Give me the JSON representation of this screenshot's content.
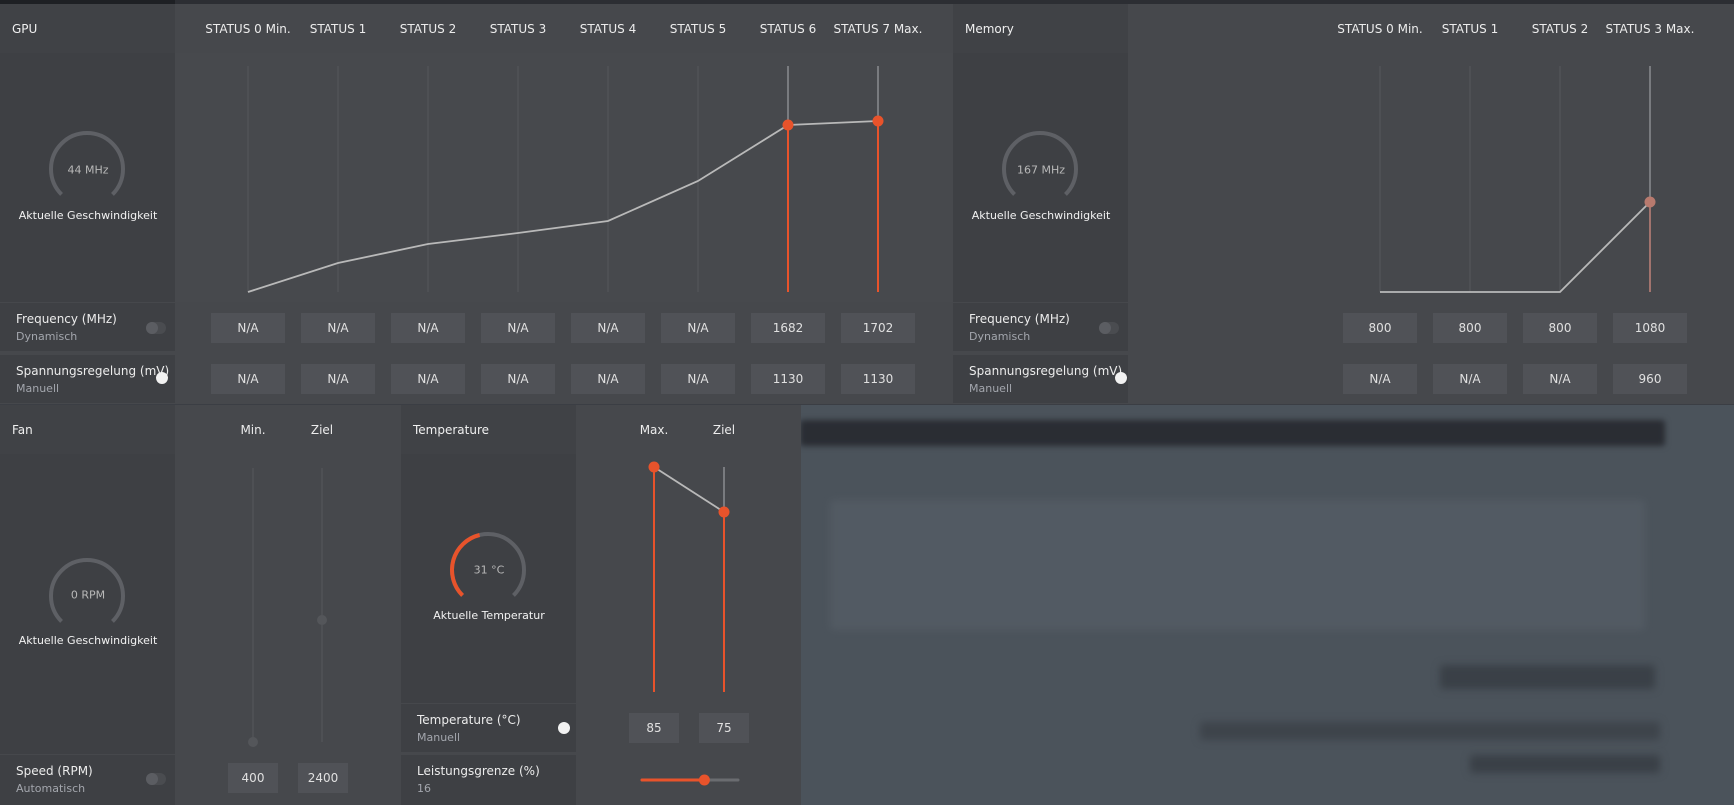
{
  "gpu": {
    "title": "GPU",
    "states": [
      "STATUS 0 Min.",
      "STATUS 1",
      "STATUS 2",
      "STATUS 3",
      "STATUS 4",
      "STATUS 5",
      "STATUS 6",
      "STATUS 7 Max."
    ],
    "gauge": {
      "value": "44 MHz",
      "label": "Aktuelle Geschwindigkeit"
    },
    "frequency": {
      "label": "Frequency (MHz)",
      "mode": "Dynamisch",
      "values": [
        "N/A",
        "N/A",
        "N/A",
        "N/A",
        "N/A",
        "N/A",
        "1682",
        "1702"
      ]
    },
    "voltage": {
      "label": "Spannungsregelung (mV)",
      "mode": "Manuell",
      "values": [
        "N/A",
        "N/A",
        "N/A",
        "N/A",
        "N/A",
        "N/A",
        "1130",
        "1130"
      ]
    }
  },
  "memory": {
    "title": "Memory",
    "states": [
      "STATUS 0 Min.",
      "STATUS 1",
      "STATUS 2",
      "STATUS 3 Max."
    ],
    "gauge": {
      "value": "167 MHz",
      "label": "Aktuelle Geschwindigkeit"
    },
    "frequency": {
      "label": "Frequency (MHz)",
      "mode": "Dynamisch",
      "values": [
        "800",
        "800",
        "800",
        "1080"
      ]
    },
    "voltage": {
      "label": "Spannungsregelung (mV)",
      "mode": "Manuell",
      "values": [
        "N/A",
        "N/A",
        "N/A",
        "960"
      ]
    }
  },
  "fan": {
    "title": "Fan",
    "cols": [
      "Min.",
      "Ziel"
    ],
    "gauge": {
      "value": "0 RPM",
      "label": "Aktuelle Geschwindigkeit"
    },
    "speed": {
      "label": "Speed (RPM)",
      "mode": "Automatisch",
      "values": [
        "400",
        "2400"
      ]
    }
  },
  "temperature": {
    "title": "Temperature",
    "cols": [
      "Max.",
      "Ziel"
    ],
    "gauge": {
      "value": "31 °C",
      "label": "Aktuelle Temperatur"
    },
    "setting": {
      "label": "Temperature (°C)",
      "mode": "Manuell",
      "values": [
        "85",
        "75"
      ]
    },
    "power": {
      "label": "Leistungsgrenze (%)",
      "value": "16",
      "slider_fraction": 0.65
    }
  },
  "colors": {
    "accent": "#e8532b",
    "line": "#b9b9b9"
  }
}
